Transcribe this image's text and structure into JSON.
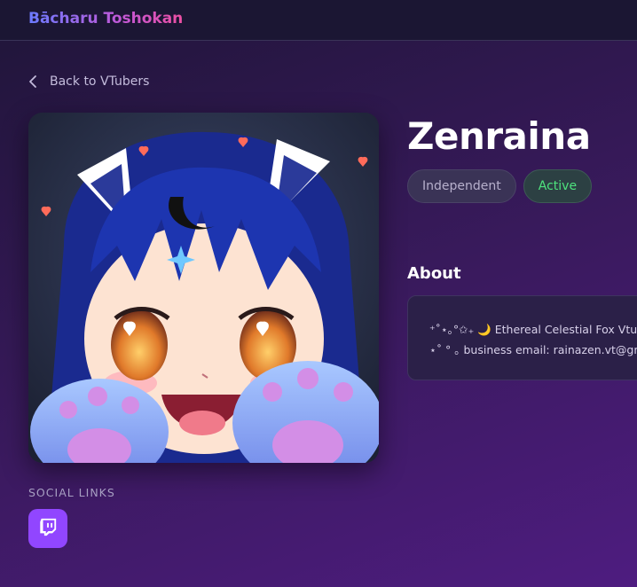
{
  "header": {
    "brand": "Bācharu Toshokan"
  },
  "nav": {
    "back_label": "Back to VTubers"
  },
  "profile": {
    "name": "Zenraina",
    "avatar_alt": "Zenraina avatar",
    "badges": [
      {
        "label": "Independent"
      },
      {
        "label": "Active"
      }
    ]
  },
  "about": {
    "title": "About",
    "lines": [
      "⁺˚⋆｡°✩₊ 🌙 Ethereal Celestial Fox Vtuber",
      "⋆˚ ° ｡ business email: rainazen.vt@gmail.com"
    ]
  },
  "social": {
    "title": "SOCIAL LINKS",
    "links": [
      {
        "icon": "twitch-icon",
        "color": "#9146ff"
      }
    ]
  },
  "colors": {
    "accent": "#9146ff",
    "active": "#4ee27d",
    "brand_start": "#6b7bff",
    "brand_end": "#ec4fa3"
  }
}
